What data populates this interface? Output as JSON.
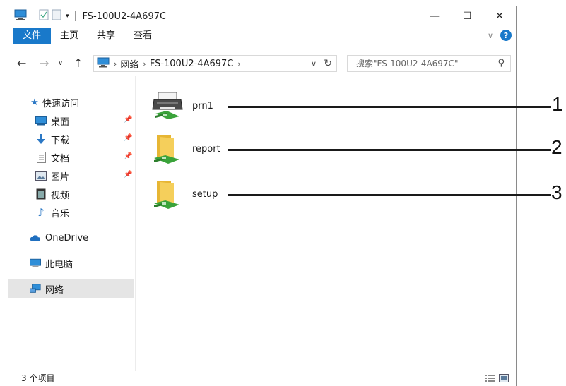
{
  "window": {
    "title": "FS-100U2-4A697C"
  },
  "titlebar": {
    "minimize": "—",
    "maximize": "☐",
    "close": "✕"
  },
  "ribbon": {
    "tabs": [
      "文件",
      "主页",
      "共享",
      "查看"
    ]
  },
  "address": {
    "breadcrumbs": [
      "网络",
      "FS-100U2-4A697C"
    ],
    "search_placeholder": "搜索\"FS-100U2-4A697C\""
  },
  "sidebar": {
    "quick_access": "快速访问",
    "items": [
      {
        "label": "桌面",
        "pinned": true,
        "icon": "desktop-icon"
      },
      {
        "label": "下载",
        "pinned": true,
        "icon": "download-icon"
      },
      {
        "label": "文档",
        "pinned": true,
        "icon": "document-icon"
      },
      {
        "label": "图片",
        "pinned": true,
        "icon": "picture-icon"
      },
      {
        "label": "视频",
        "pinned": false,
        "icon": "video-icon"
      },
      {
        "label": "音乐",
        "pinned": false,
        "icon": "music-icon"
      }
    ],
    "onedrive": "OneDrive",
    "this_pc": "此电脑",
    "network": "网络"
  },
  "content": {
    "items": [
      {
        "name": "prn1",
        "type": "printer",
        "callout": "1"
      },
      {
        "name": "report",
        "type": "shared-folder",
        "callout": "2"
      },
      {
        "name": "setup",
        "type": "shared-folder",
        "callout": "3"
      }
    ]
  },
  "status": {
    "item_count": "3 个项目"
  },
  "colors": {
    "accent": "#1979ca",
    "folder": "#f0c84a",
    "network_green": "#3aa33a",
    "selected_bg": "#e5e5e5"
  }
}
